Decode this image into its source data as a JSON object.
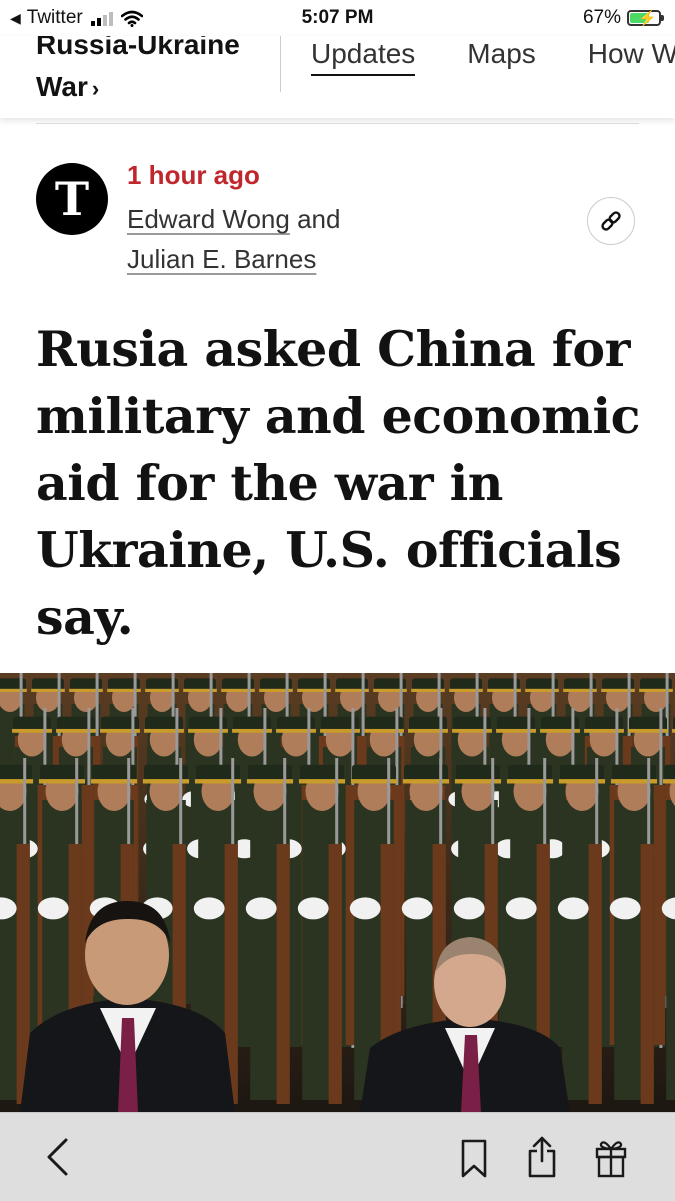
{
  "status_bar": {
    "back_app": "Twitter",
    "time": "5:07 PM",
    "battery_percent": "67%",
    "battery_level": 0.67,
    "signal_bars": 2
  },
  "header": {
    "section_title": "Russia-Ukraine War",
    "section_chevron": "›",
    "tabs": [
      "Updates",
      "Maps",
      "How W"
    ]
  },
  "article": {
    "timestamp": "1 hour ago",
    "authors": [
      "Edward Wong",
      "Julian E. Barnes"
    ],
    "author_joiner": "and",
    "logo_letter": "T",
    "headline": "Rusia asked China for military and economic aid for the war in Ukraine, U.S. officials say."
  },
  "toolbar": {
    "icons": [
      "back-chevron-icon",
      "bookmark-icon",
      "share-icon",
      "gift-icon"
    ]
  },
  "colors": {
    "timestamp_red": "#c0272d",
    "toolbar_bg": "#dedede"
  }
}
